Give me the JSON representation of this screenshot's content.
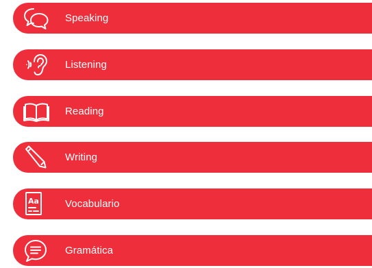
{
  "colors": {
    "accent": "#ef2e3b",
    "text": "#ffffff"
  },
  "menu": {
    "items": [
      {
        "label": "Speaking",
        "icon": "speech-bubbles-icon"
      },
      {
        "label": "Listening",
        "icon": "ear-icon"
      },
      {
        "label": "Reading",
        "icon": "open-book-icon"
      },
      {
        "label": "Writing",
        "icon": "pencil-icon"
      },
      {
        "label": "Vocabulario",
        "icon": "dictionary-icon"
      },
      {
        "label": "Gramática",
        "icon": "chat-bubble-icon"
      }
    ]
  }
}
